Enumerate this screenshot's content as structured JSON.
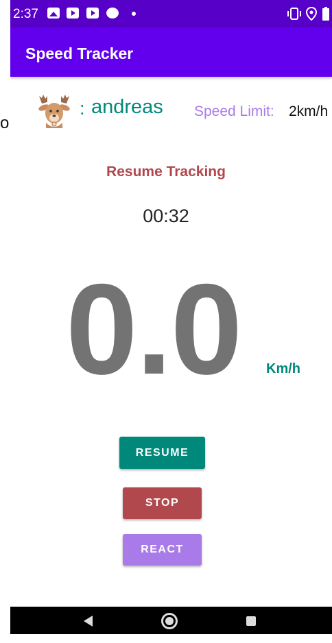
{
  "status_bar": {
    "time": "2:37",
    "left_icons": [
      "image-icon",
      "play-icon",
      "play-icon",
      "messenger-icon",
      "dot-icon"
    ],
    "right_icons": [
      "vibrate-icon",
      "location-icon",
      "battery-icon"
    ]
  },
  "app_bar": {
    "title": "Speed Tracker"
  },
  "stray_text": "o",
  "user": {
    "avatar": "deer-avatar-icon",
    "separator": ":",
    "name": "andreas"
  },
  "speed_limit": {
    "label": "Speed Limit:",
    "value": "2km/h"
  },
  "tracking": {
    "status": "Resume Tracking",
    "timer": "00:32"
  },
  "speedometer": {
    "value": "0.0",
    "unit": "Km/h"
  },
  "buttons": {
    "resume": "RESUME",
    "stop": "STOP",
    "react": "REACT"
  },
  "colors": {
    "status_bar": "#5700c8",
    "app_bar": "#6200ee",
    "teal": "#00897b",
    "red": "#b0484e",
    "lavender": "#a97be8"
  },
  "nav_bar": {
    "icons": [
      "back-icon",
      "home-icon",
      "recents-icon"
    ]
  }
}
